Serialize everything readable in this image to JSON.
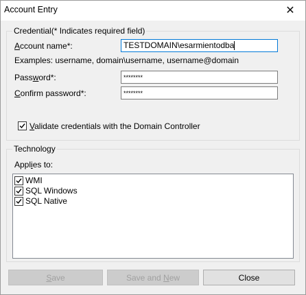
{
  "window": {
    "title": "Account Entry",
    "close_glyph": "✕"
  },
  "credential": {
    "legend": "Credential(* Indicates required field)",
    "account_label_pre": "A",
    "account_label_rest": "ccount name*:",
    "account_value": "TESTDOMAIN\\esarmientodba",
    "examples": "Examples: username, domain\\username, username@domain",
    "password_label_pre": "Pass",
    "password_label_u": "w",
    "password_label_post": "ord*:",
    "password_value": "********",
    "confirm_label_pre": "C",
    "confirm_label_rest": "onfirm password*:",
    "confirm_value": "********",
    "validate_label_pre": "V",
    "validate_label_rest": "alidate credentials with the Domain Controller",
    "validate_checked": true
  },
  "technology": {
    "legend": "Technology",
    "applies_label_pre": "Appl",
    "applies_label_u": "i",
    "applies_label_post": "es to:",
    "items": [
      {
        "label": "WMI",
        "checked": true
      },
      {
        "label": "SQL Windows",
        "checked": true
      },
      {
        "label": "SQL Native",
        "checked": true
      }
    ]
  },
  "buttons": {
    "save_u": "S",
    "save_rest": "ave",
    "save_and_new_pre": "Save and ",
    "save_and_new_u": "N",
    "save_and_new_post": "ew",
    "close": "Close"
  },
  "icons": {
    "close": "close-icon",
    "checkmark": "checkmark-icon"
  }
}
